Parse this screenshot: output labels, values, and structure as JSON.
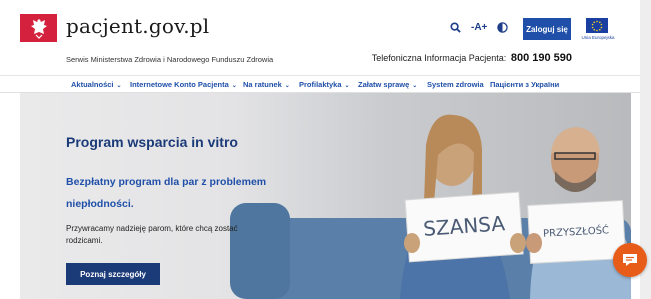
{
  "header": {
    "logo_text": "pacjent.gov.pl",
    "subtitle": "Serwis Ministerstwa Zdrowia i Narodowego Funduszu Zdrowia",
    "hotline_label": "Telefoniczna Informacja Pacjenta:",
    "hotline_number": "800 190 590",
    "font_size_toggle": "-A+",
    "login_label": "Zaloguj się",
    "eu_label": "Unia Europejska",
    "icons": [
      "eagle-emblem-icon",
      "search-icon",
      "contrast-icon",
      "eu-flag-icon"
    ]
  },
  "nav": {
    "items": [
      {
        "label": "Aktualności",
        "has_dropdown": true
      },
      {
        "label": "Internetowe Konto Pacjenta",
        "has_dropdown": true
      },
      {
        "label": "Na ratunek",
        "has_dropdown": true
      },
      {
        "label": "Profilaktyka",
        "has_dropdown": true
      },
      {
        "label": "Załatw sprawę",
        "has_dropdown": true
      },
      {
        "label": "System zdrowia",
        "has_dropdown": false
      },
      {
        "label": "Пацієнти з України",
        "has_dropdown": false
      }
    ]
  },
  "hero": {
    "title": "Program wsparcia in vitro",
    "subtitle": "Bezpłatny program dla par z problemem niepłodności.",
    "description": "Przywracamy nadzieję parom, które chcą zostać rodzicami.",
    "button_label": "Poznaj szczegóły",
    "sign_left": "SZANSA",
    "sign_right": "PRZYSZŁOŚĆ"
  },
  "chat": {
    "icon": "chat-icon"
  },
  "colors": {
    "brand_blue": "#1f4fa8",
    "dark_blue": "#1b3a78",
    "poland_red": "#d4213d",
    "chat_orange": "#e85c1a"
  }
}
